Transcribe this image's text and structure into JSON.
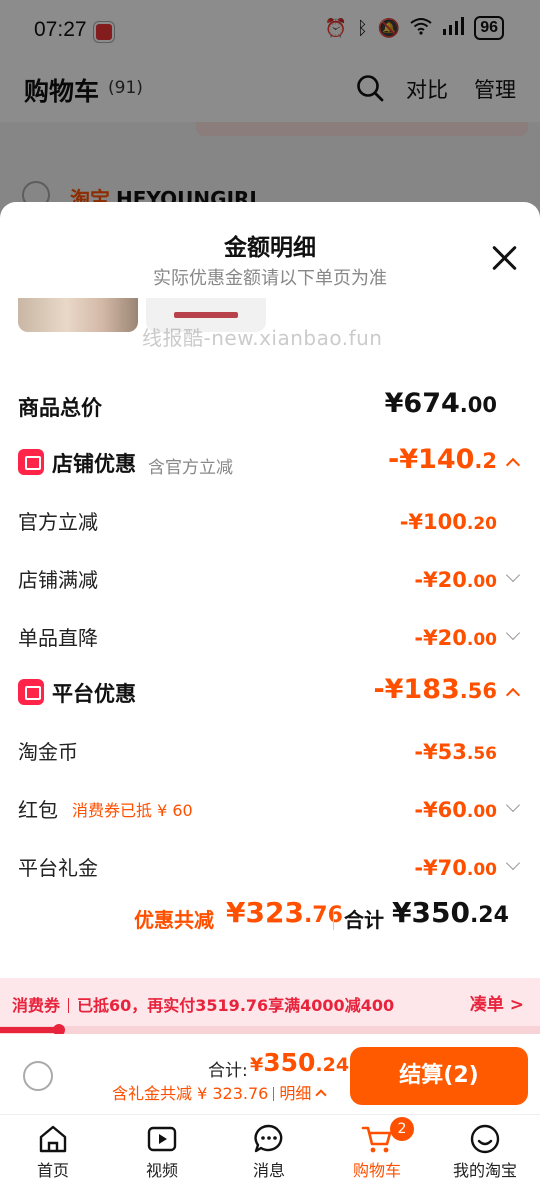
{
  "status_bar": {
    "time": "07:27",
    "battery": "96",
    "icons": [
      "alarm-icon",
      "bluetooth-icon",
      "mute-icon",
      "wifi-icon",
      "signal-icon",
      "battery-icon"
    ]
  },
  "cart": {
    "title": "购物车",
    "count": "(91)",
    "compare_label": "对比",
    "manage_label": "管理",
    "shop_prefix": "淘宝",
    "shop_name": "HEYOUNGIRL"
  },
  "sheet": {
    "title": "金额明细",
    "subtitle": "实际优惠金额请以下单页为准",
    "goods_total": {
      "label": "商品总价",
      "int": "¥674",
      "dec": ".00"
    },
    "store_discount": {
      "label": "店铺优惠",
      "note": "含官方立减",
      "int": "-¥140",
      "dec": ".2",
      "items": [
        {
          "label": "官方立减",
          "int": "-¥100",
          "dec": ".20"
        },
        {
          "label": "店铺满减",
          "int": "-¥20",
          "dec": ".00"
        },
        {
          "label": "单品直降",
          "int": "-¥20",
          "dec": ".00"
        }
      ]
    },
    "platform_discount": {
      "label": "平台优惠",
      "int": "-¥183",
      "dec": ".56",
      "items": [
        {
          "label": "淘金币",
          "int": "-¥53",
          "dec": ".56",
          "note": ""
        },
        {
          "label": "红包",
          "int": "-¥60",
          "dec": ".00",
          "note": "消费券已抵 ¥ 60"
        },
        {
          "label": "平台礼金",
          "int": "-¥70",
          "dec": ".00",
          "note": ""
        }
      ]
    },
    "summary": {
      "discount_label": "优惠共减",
      "discount_int": "¥323",
      "discount_dec": ".76",
      "total_label": "合计",
      "total_int": "¥350",
      "total_dec": ".24"
    },
    "watermark": "线报酷-new.xianbao.fun"
  },
  "coupon": {
    "tag": "消费券",
    "text": "已抵60，再实付3519.76享满4000减400",
    "link": "凑单 >",
    "progress": 0.11
  },
  "checkout": {
    "total_label": "合计:",
    "total_sym": "¥",
    "total_int": "350",
    "total_dec": ".24",
    "gift_text": "含礼金共减 ¥ 323.76",
    "detail_label": "明细",
    "pay_label": "结算(2)"
  },
  "tabbar": {
    "tabs": [
      {
        "label": "首页",
        "icon": "home-icon"
      },
      {
        "label": "视频",
        "icon": "video-icon"
      },
      {
        "label": "消息",
        "icon": "message-icon"
      },
      {
        "label": "购物车",
        "icon": "cart-icon",
        "badge": "2",
        "active": true
      },
      {
        "label": "我的淘宝",
        "icon": "profile-icon"
      }
    ]
  },
  "colors": {
    "accent": "#ff5000",
    "coupon_red": "#e8233c",
    "section_icon": "#ff2448"
  }
}
